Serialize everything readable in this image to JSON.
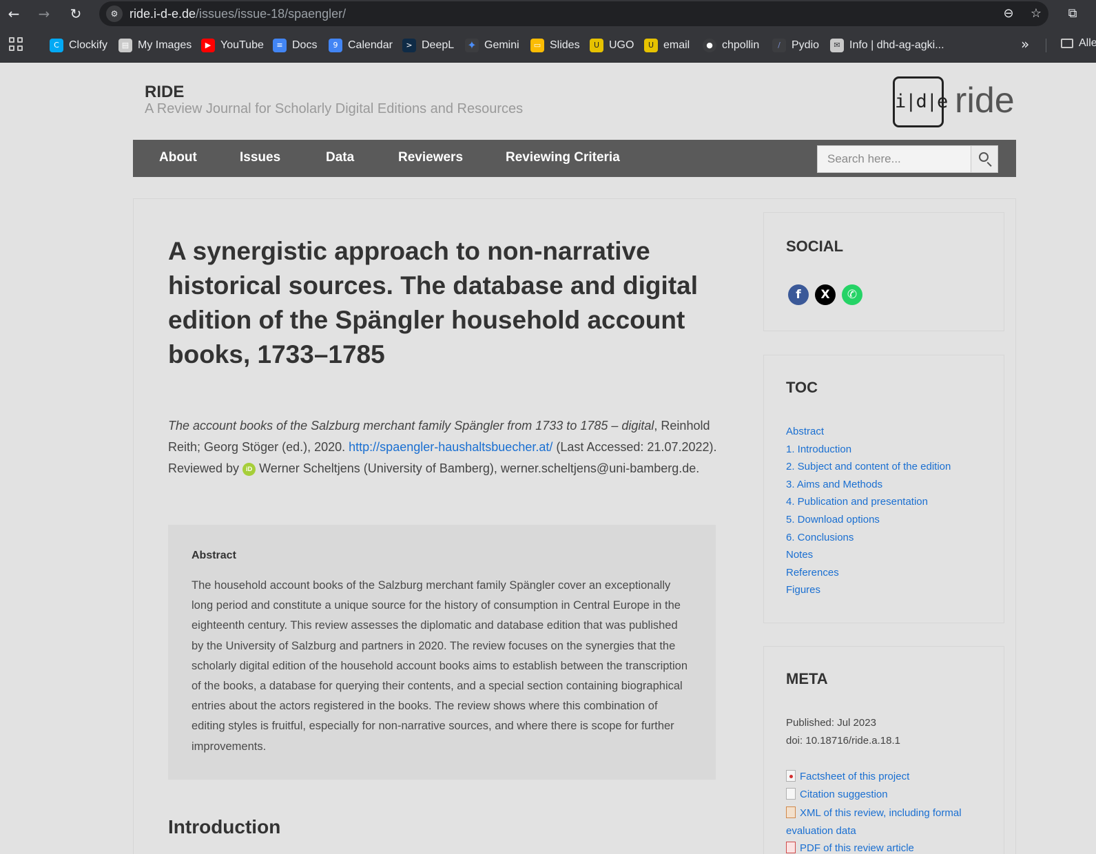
{
  "browser": {
    "url_host": "ride.i-d-e.de",
    "url_path": "/issues/issue-18/spaengler/"
  },
  "bookmarks": [
    {
      "label": "Clockify",
      "color": "#03a9f4",
      "glyph": "C"
    },
    {
      "label": "My Images",
      "color": "#c9c9c9",
      "glyph": "▤"
    },
    {
      "label": "YouTube",
      "color": "#ff0000",
      "glyph": "▶"
    },
    {
      "label": "Docs",
      "color": "#4285f4",
      "glyph": "≡"
    },
    {
      "label": "Calendar",
      "color": "#4285f4",
      "glyph": "9"
    },
    {
      "label": "DeepL",
      "color": "#0f2b46",
      "glyph": ">"
    },
    {
      "label": "Gemini",
      "color": "#3c3d40",
      "glyph": "✦"
    },
    {
      "label": "Slides",
      "color": "#fbbc04",
      "glyph": "▭"
    },
    {
      "label": "UGO",
      "color": "#e6c200",
      "glyph": "U"
    },
    {
      "label": "email",
      "color": "#e6c200",
      "glyph": "U"
    },
    {
      "label": "chpollin",
      "color": "#3c3d40",
      "glyph": "●"
    },
    {
      "label": "Pydio",
      "color": "#3c3d40",
      "glyph": "/"
    },
    {
      "label": "Info | dhd-ag-agki...",
      "color": "#c9c9c9",
      "glyph": "✉"
    }
  ],
  "bookmarks_folder": "Alle",
  "site": {
    "title": "RIDE",
    "subtitle": "A Review Journal for Scholarly Digital Editions and Resources",
    "logo_mark": "i|d|e",
    "logo_text": "ride"
  },
  "nav": {
    "items": [
      "About",
      "Issues",
      "Data",
      "Reviewers",
      "Reviewing Criteria"
    ],
    "search_placeholder": "Search here..."
  },
  "article": {
    "title": "A synergistic approach to non-narrative historical sources. The database and digital edition of the Spängler household account books, 1733–1785",
    "citation_italic": "The account books of the Salzburg merchant family Spängler from 1733 to 1785 – digital",
    "citation_editors": ", Reinhold Reith; Georg Stöger (ed.), 2020. ",
    "citation_link": "http://spaengler-haushaltsbuecher.at/",
    "citation_accessed": " (Last Accessed: 21.07.2022). Reviewed by ",
    "reviewer": " Werner Scheltjens (University of Bamberg), werner.scheltjens@uni-bamberg.de.",
    "abstract_heading": "Abstract",
    "abstract_text": "The household account books of the Salzburg merchant family Spängler cover an exceptionally long period and constitute a unique source for the history of consumption in Central Europe in the eighteenth century. This review assesses the diplomatic and database edition that was published by the University of Salzburg and partners in 2020. The review focuses on the synergies that the scholarly digital edition of the household account books aims to establish between the transcription of the books, a database for querying their contents, and a special section containing biographical entries about the actors registered in the books. The review shows where this combination of editing styles is fruitful, especially for non-narrative sources, and where there is scope for further improvements.",
    "intro_heading": "Introduction"
  },
  "sidebar": {
    "social_title": "SOCIAL",
    "social": [
      {
        "name": "facebook",
        "glyph": "f",
        "color": "#3b5998"
      },
      {
        "name": "x",
        "glyph": "X",
        "color": "#000000"
      },
      {
        "name": "whatsapp",
        "glyph": "✆",
        "color": "#25d366"
      }
    ],
    "toc_title": "TOC",
    "toc": [
      "Abstract",
      "1. Introduction",
      "2. Subject and content of the edition",
      "3. Aims and Methods",
      "4. Publication and presentation",
      "5. Download options",
      "6. Conclusions",
      "Notes",
      "References",
      "Figures"
    ],
    "meta_title": "META",
    "published": "Published: Jul 2023",
    "doi": "doi: 10.18716/ride.a.18.1",
    "links": [
      "Factsheet of this project",
      "Citation suggestion",
      "XML of this review, including formal evaluation data",
      "PDF of this review article"
    ]
  }
}
